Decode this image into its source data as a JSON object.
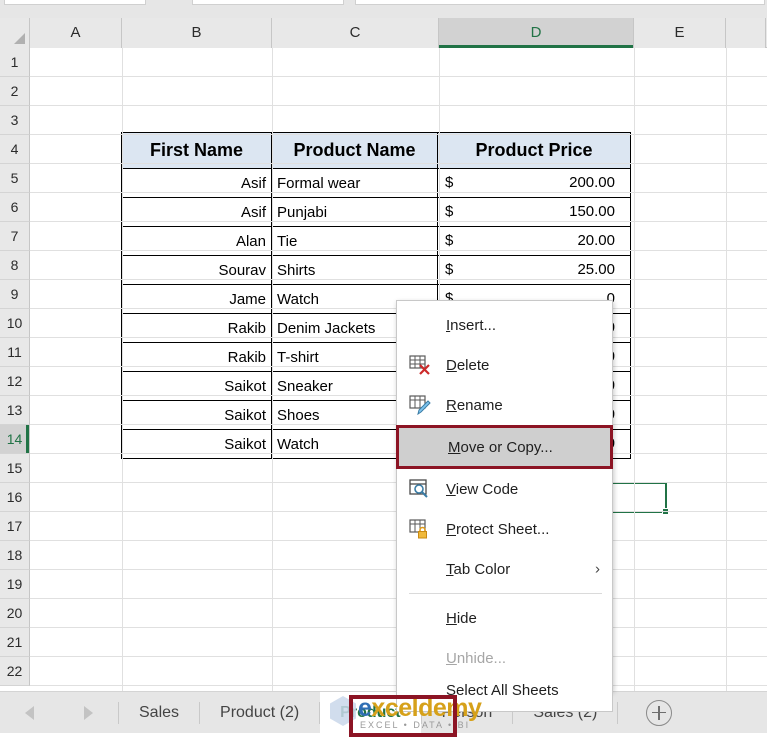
{
  "grid": {
    "columns": [
      "A",
      "B",
      "C",
      "D",
      "E"
    ],
    "selected_column": "D",
    "rows": [
      "1",
      "2",
      "3",
      "4",
      "5",
      "6",
      "7",
      "8",
      "9",
      "10",
      "11",
      "12",
      "13",
      "14",
      "15",
      "16",
      "17",
      "18",
      "19",
      "20",
      "21",
      "22"
    ],
    "selected_row": "14",
    "active_cell": "D14"
  },
  "table": {
    "headers": [
      "First Name",
      "Product Name",
      "Product Price"
    ],
    "rows": [
      {
        "first_name": "Asif",
        "product": "Formal wear",
        "currency": "$",
        "price": "200.00"
      },
      {
        "first_name": "Asif",
        "product": "Punjabi",
        "currency": "$",
        "price": "150.00"
      },
      {
        "first_name": "Alan",
        "product": "Tie",
        "currency": "$",
        "price": "20.00"
      },
      {
        "first_name": "Sourav",
        "product": "Shirts",
        "currency": "$",
        "price": "25.00"
      },
      {
        "first_name": "Jame",
        "product": "Watch",
        "currency": "$",
        "price": "0"
      },
      {
        "first_name": "Rakib",
        "product": "Denim Jackets",
        "currency": "$",
        "price": "0"
      },
      {
        "first_name": "Rakib",
        "product": "T-shirt",
        "currency": "$",
        "price": "0"
      },
      {
        "first_name": "Saikot",
        "product": "Sneaker",
        "currency": "$",
        "price": "0"
      },
      {
        "first_name": "Saikot",
        "product": "Shoes",
        "currency": "$",
        "price": "0"
      },
      {
        "first_name": "Saikot",
        "product": "Watch",
        "currency": "$",
        "price": "0"
      }
    ]
  },
  "context_menu": {
    "items": [
      {
        "label": "Insert...",
        "accel": "I",
        "icon": "none",
        "state": "normal",
        "submenu": false
      },
      {
        "label": "Delete",
        "accel": "D",
        "icon": "delete-sheet",
        "state": "normal",
        "submenu": false
      },
      {
        "label": "Rename",
        "accel": "R",
        "icon": "rename-sheet",
        "state": "normal",
        "submenu": false
      },
      {
        "label": "Move or Copy...",
        "accel": "M",
        "icon": "none",
        "state": "highlight",
        "submenu": false
      },
      {
        "label": "View Code",
        "accel": "V",
        "icon": "view-code",
        "state": "normal",
        "submenu": false
      },
      {
        "label": "Protect Sheet...",
        "accel": "P",
        "icon": "protect-sheet",
        "state": "normal",
        "submenu": false
      },
      {
        "label": "Tab Color",
        "accel": "T",
        "icon": "none",
        "state": "normal",
        "submenu": true
      },
      {
        "label": "Hide",
        "accel": "H",
        "icon": "none",
        "state": "normal",
        "submenu": false
      },
      {
        "label": "Unhide...",
        "accel": "U",
        "icon": "none",
        "state": "disabled",
        "submenu": false
      },
      {
        "label": "Select All Sheets",
        "accel": "S",
        "icon": "none",
        "state": "normal",
        "submenu": false
      }
    ],
    "highlight_border_color": "#8c1424",
    "submenu_arrow": "›"
  },
  "tabbar": {
    "nav_prev": "previous-sheet",
    "nav_next": "next-sheet",
    "tabs": [
      {
        "label": "Sales",
        "active": false
      },
      {
        "label": "Product (2)",
        "active": false
      },
      {
        "label": "Product",
        "active": true
      },
      {
        "label": "Person",
        "active": false
      },
      {
        "label": "Sales (2)",
        "active": false
      }
    ],
    "add_sheet_label": "+",
    "active_tab_color": "#217346",
    "highlight_color": "#8c1424"
  },
  "watermark": {
    "part1": "e",
    "part2": "x",
    "part3": "celdemy",
    "subtitle": "EXCEL • DATA • BI"
  }
}
